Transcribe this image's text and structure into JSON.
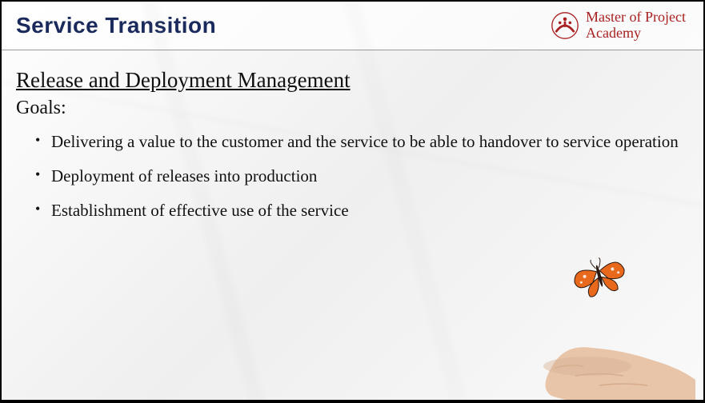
{
  "header": {
    "title": "Service Transition"
  },
  "brand": {
    "line1": "Master of Project",
    "line2": "Academy"
  },
  "section": {
    "title": "Release and Deployment Management",
    "goals_label": "Goals:",
    "bullets": [
      "Delivering a value to the customer and the service to be able to handover to service operation",
      "Deployment of releases into production",
      "Establishment of effective use of the service"
    ]
  }
}
